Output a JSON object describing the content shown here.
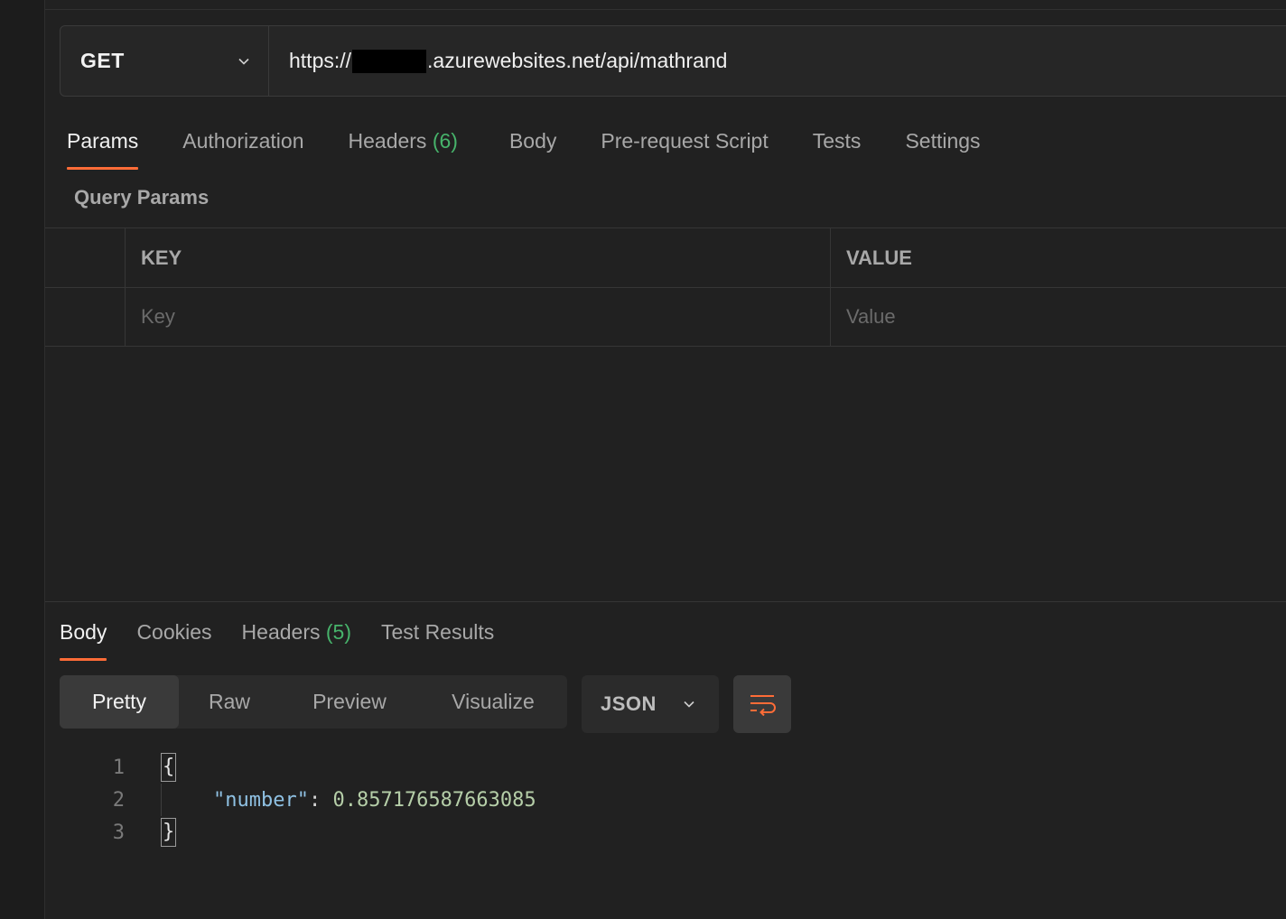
{
  "request": {
    "method": "GET",
    "url_prefix": "https://",
    "url_suffix": ".azurewebsites.net/api/mathrand"
  },
  "request_tabs": [
    {
      "label": "Params"
    },
    {
      "label": "Authorization"
    },
    {
      "label": "Headers",
      "count": "(6)"
    },
    {
      "label": "Body"
    },
    {
      "label": "Pre-request Script"
    },
    {
      "label": "Tests"
    },
    {
      "label": "Settings"
    }
  ],
  "query_params": {
    "title": "Query Params",
    "header_key": "KEY",
    "header_value": "VALUE",
    "placeholder_key": "Key",
    "placeholder_value": "Value"
  },
  "response_tabs": [
    {
      "label": "Body"
    },
    {
      "label": "Cookies"
    },
    {
      "label": "Headers",
      "count": "(5)"
    },
    {
      "label": "Test Results"
    }
  ],
  "view_modes": [
    "Pretty",
    "Raw",
    "Preview",
    "Visualize"
  ],
  "format": "JSON",
  "response_body": {
    "line_numbers": [
      "1",
      "2",
      "3"
    ],
    "open_brace": "{",
    "key": "\"number\"",
    "colon": ": ",
    "value": "0.857176587663085",
    "close_brace": "}"
  },
  "colors": {
    "accent": "#ff6c37",
    "count_green": "#47b36b"
  }
}
